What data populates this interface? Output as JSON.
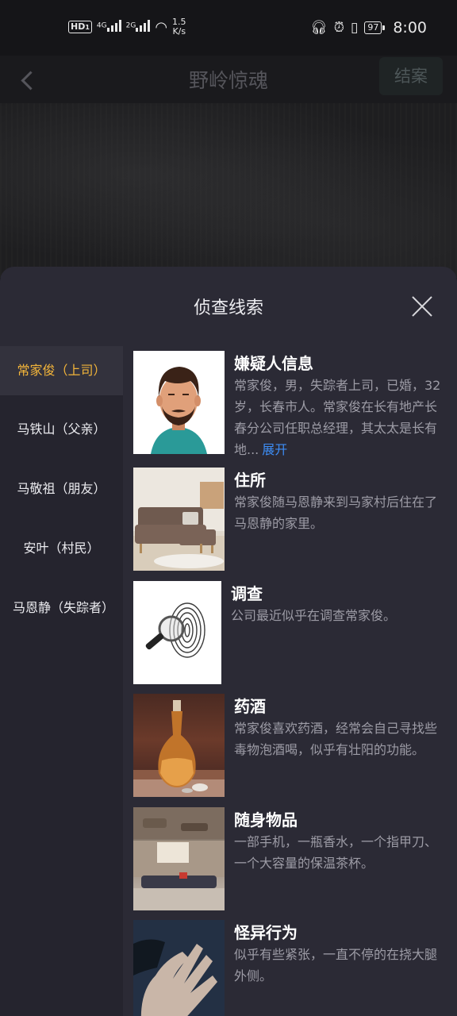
{
  "status_bar": {
    "hd_label": "HD",
    "hd_sub": "1",
    "net1": "4G",
    "net2": "2G",
    "speed_value": "1.5",
    "speed_unit": "K/s",
    "battery": "97",
    "time": "8:00"
  },
  "nav": {
    "title": "野岭惊魂",
    "close_case_label": "结案"
  },
  "sheet": {
    "title": "侦查线索"
  },
  "suspects": [
    {
      "label": "常家俊（上司）",
      "active": true
    },
    {
      "label": "马铁山（父亲）",
      "active": false
    },
    {
      "label": "马敬祖（朋友）",
      "active": false
    },
    {
      "label": "安叶（村民）",
      "active": false
    },
    {
      "label": "马恩静（失踪者）",
      "active": false
    }
  ],
  "clues": [
    {
      "title": "嫌疑人信息",
      "desc": "常家俊，男，失踪者上司，已婚，32岁，长春市人。常家俊在长有地产长春分公司任职总经理，其太太是长有地...",
      "expand": "展开",
      "image_icon": "avatar-illustration"
    },
    {
      "title": "住所",
      "desc": "常家俊随马恩静来到马家村后住在了马恩静的家里。",
      "image_icon": "sofa-photo"
    },
    {
      "title": "调查",
      "desc": "公司最近似乎在调查常家俊。",
      "image_icon": "magnifier-fingerprint"
    },
    {
      "title": "药酒",
      "desc": "常家俊喜欢药酒，经常会自己寻找些毒物泡酒喝，似乎有壮阳的功能。",
      "image_icon": "wine-bottle-photo"
    },
    {
      "title": "随身物品",
      "desc": "一部手机，一瓶香水，一个指甲刀、一个大容量的保温茶杯。",
      "image_icon": "belongings-photo"
    },
    {
      "title": "怪异行为",
      "desc": "似乎有些紧张，一直不停的在挠大腿外侧。",
      "image_icon": "hand-photo"
    }
  ],
  "colors": {
    "active_suspect": "#f2b43a",
    "expand_link": "#3d8df5",
    "sheet_bg": "#2b2a35"
  }
}
